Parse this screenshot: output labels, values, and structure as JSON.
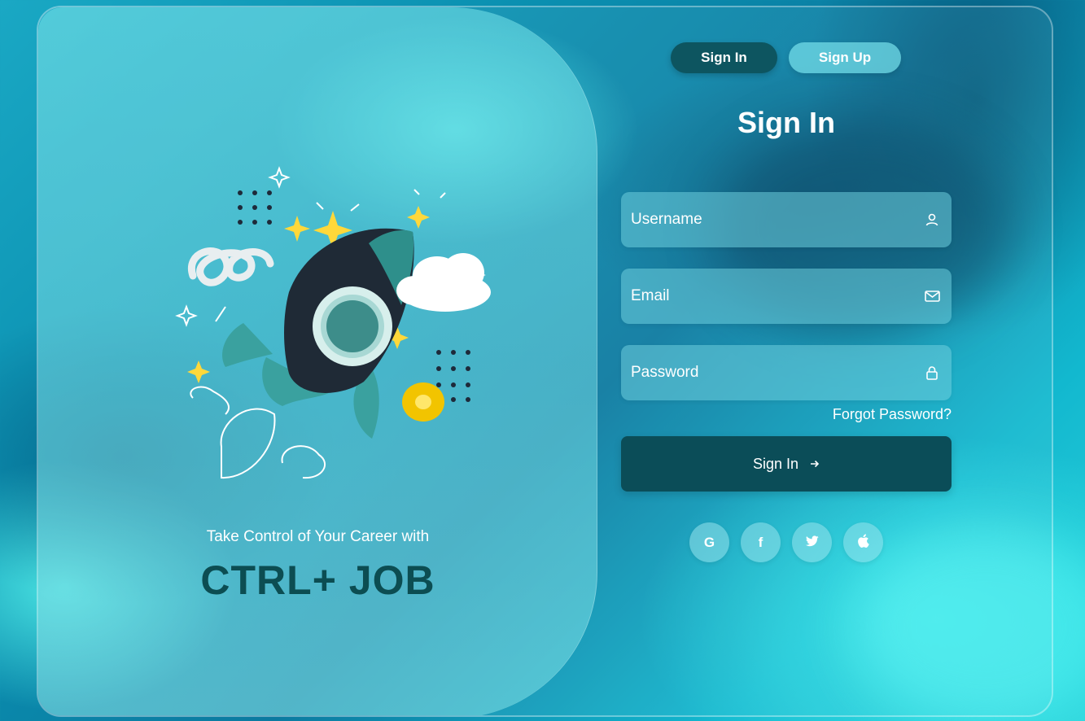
{
  "hero": {
    "tagline": "Take Control of Your Career with",
    "brand": "CTRL+ JOB"
  },
  "tabs": [
    {
      "label": "Sign In",
      "active": true
    },
    {
      "label": "Sign Up",
      "active": false
    }
  ],
  "form": {
    "title": "Sign In",
    "username_placeholder": "Username",
    "email_placeholder": "Email",
    "password_placeholder": "Password",
    "forgot_label": "Forgot Password?",
    "submit_label": "Sign In",
    "submit_icon": "arrow-right-icon"
  },
  "social": [
    {
      "name": "google",
      "glyph": "G"
    },
    {
      "name": "facebook",
      "glyph": "f"
    },
    {
      "name": "twitter",
      "glyph": ""
    },
    {
      "name": "apple",
      "glyph": ""
    }
  ],
  "colors": {
    "accent_dark": "#0b4d58",
    "brand_text": "#0c4d52",
    "text_light": "#ffffff"
  }
}
